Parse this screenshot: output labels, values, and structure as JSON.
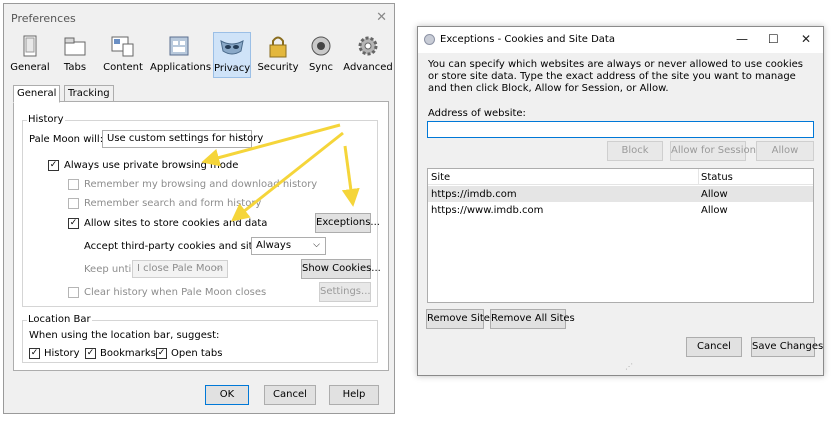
{
  "preferences": {
    "title": "Preferences",
    "toolbar": [
      {
        "label": "General",
        "icon": "general-icon"
      },
      {
        "label": "Tabs",
        "icon": "tabs-icon"
      },
      {
        "label": "Content",
        "icon": "content-icon"
      },
      {
        "label": "Applications",
        "icon": "applications-icon"
      },
      {
        "label": "Privacy",
        "icon": "privacy-mask-icon"
      },
      {
        "label": "Security",
        "icon": "padlock-icon"
      },
      {
        "label": "Sync",
        "icon": "sync-icon"
      },
      {
        "label": "Advanced",
        "icon": "gear-icon"
      }
    ],
    "active_tab": "Privacy",
    "subtabs": [
      "General",
      "Tracking"
    ],
    "history": {
      "group_label": "History",
      "will_label": "Pale Moon will:",
      "will_value": "Use custom settings for history",
      "always_private": "Always use private browsing mode",
      "remember_browsing": "Remember my browsing and download history",
      "remember_search": "Remember search and form history",
      "allow_cookies": "Allow sites to store cookies and data",
      "exceptions_button": "Exceptions...",
      "third_party_label": "Accept third-party cookies and site data:",
      "third_party_value": "Always",
      "keep_until_label": "Keep until:",
      "keep_until_value": "I close Pale Moon",
      "show_cookies_button": "Show Cookies...",
      "clear_history": "Clear history when Pale Moon closes",
      "settings_button": "Settings..."
    },
    "location_bar": {
      "group_label": "Location Bar",
      "suggest_label": "When using the location bar, suggest:",
      "history": "History",
      "bookmarks": "Bookmarks",
      "open_tabs": "Open tabs"
    },
    "buttons": {
      "ok": "OK",
      "cancel": "Cancel",
      "help": "Help"
    },
    "arrow_color": "#f5d53a"
  },
  "exceptions": {
    "title": "Exceptions - Cookies and Site Data",
    "description": "You can specify which websites are always or never allowed to use cookies or store site data. Type the exact address of the site you want to manage and then click Block, Allow for Session, or Allow.",
    "address_label": "Address of website:",
    "address_value": "",
    "block_button": "Block",
    "allow_session_button": "Allow for Session",
    "allow_button": "Allow",
    "columns": [
      "Site",
      "Status"
    ],
    "rows": [
      {
        "site": "https://imdb.com",
        "status": "Allow"
      },
      {
        "site": "https://www.imdb.com",
        "status": "Allow"
      }
    ],
    "remove_site_button": "Remove Site",
    "remove_all_button": "Remove All Sites",
    "cancel_button": "Cancel",
    "save_button": "Save Changes"
  }
}
